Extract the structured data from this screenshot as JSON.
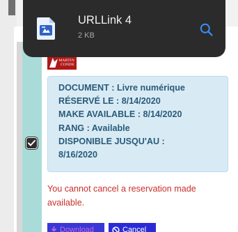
{
  "notification": {
    "file_name": "URLLink 4",
    "file_size": "2 KB",
    "icon": "file-icon",
    "action_icon": "search-icon"
  },
  "record": {
    "publisher_logo_lines": [
      "MARTIN",
      "CONDE"
    ],
    "selected": true,
    "details": [
      "DOCUMENT : Livre numérique",
      "RÉSERVÉ LE : 8/14/2020",
      "MAKE AVAILABLE : 8/14/2020",
      "RANG : Available",
      "DISPONIBLE JUSQU'AU :",
      "8/16/2020"
    ],
    "error_message": "You cannot cancel a reservation made available.",
    "download_label": "Download",
    "cancel_label": "Cancel"
  },
  "colors": {
    "accent_teal": "#a9dcd9",
    "info_bg": "#d8ebf5",
    "info_text": "#2a5a78",
    "error": "#c9302c",
    "button": "#2b2bd6",
    "notification_bg": "#2b2b2b",
    "notification_action": "#3b8ff5"
  }
}
